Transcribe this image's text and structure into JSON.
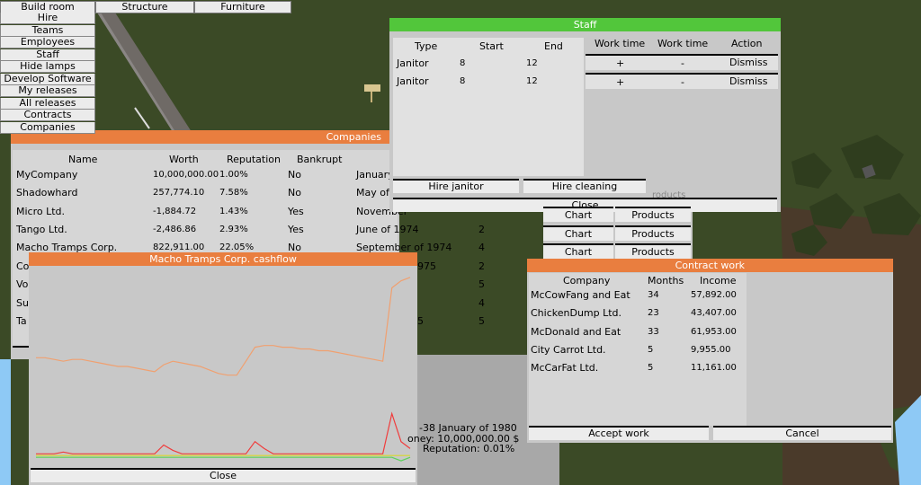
{
  "topbar": {
    "build_room": "Build room",
    "structure": "Structure",
    "furniture": "Furniture"
  },
  "sidebar": [
    "Hire",
    "Teams",
    "Employees",
    "Staff",
    "Hide lamps",
    "Develop Software",
    "My releases",
    "All releases",
    "Contracts",
    "Companies"
  ],
  "companies": {
    "title": "Companies",
    "headers": [
      "Name",
      "Worth",
      "Reputation",
      "Bankrupt"
    ],
    "rows": [
      {
        "name": "MyCompany",
        "worth": "10,000,000.00",
        "reputation": "1.00%",
        "bankrupt": "No",
        "founded": "January",
        "count": ""
      },
      {
        "name": "Shadowhard",
        "worth": "257,774.10",
        "reputation": "7.58%",
        "bankrupt": "No",
        "founded": "May of",
        "count": ""
      },
      {
        "name": "Micro Ltd.",
        "worth": "-1,884.72",
        "reputation": "1.43%",
        "bankrupt": "Yes",
        "founded": "November",
        "count": ""
      },
      {
        "name": "Tango Ltd.",
        "worth": "-2,486.86",
        "reputation": "2.93%",
        "bankrupt": "Yes",
        "founded": "June of 1974",
        "count": "2"
      },
      {
        "name": "Macho Tramps Corp.",
        "worth": "822,911.00",
        "reputation": "22.05%",
        "bankrupt": "No",
        "founded": "September of 1974",
        "count": "4"
      }
    ],
    "partial_rows": [
      {
        "name": "Co",
        "founded": "975",
        "count": "2"
      },
      {
        "name": "Vo",
        "founded": "",
        "count": "5"
      },
      {
        "name": "Su",
        "founded": "",
        "count": "4"
      },
      {
        "name": "Ta",
        "founded": "5",
        "count": "5"
      }
    ]
  },
  "staff": {
    "title": "Staff",
    "headers": [
      "Type",
      "Start",
      "End",
      "Work time",
      "Work time",
      "Action"
    ],
    "rows": [
      {
        "type": "Janitor",
        "start": "8",
        "end": "12",
        "plus": "+",
        "minus": "-",
        "action": "Dismiss"
      },
      {
        "type": "Janitor",
        "start": "8",
        "end": "12",
        "plus": "+",
        "minus": "-",
        "action": "Dismiss"
      }
    ],
    "hire_janitor": "Hire janitor",
    "hire_cleaning": "Hire cleaning",
    "close": "Close",
    "behind_text": "roducts"
  },
  "chart_buttons": [
    {
      "chart": "Chart",
      "products": "Products"
    },
    {
      "chart": "Chart",
      "products": "Products"
    },
    {
      "chart": "Chart",
      "products": "Products"
    }
  ],
  "cashflow": {
    "title": "Macho Tramps Corp. cashflow",
    "close": "Close",
    "chart_data": {
      "type": "line",
      "title": "Macho Tramps Corp. cashflow",
      "xlabel": "",
      "ylabel": "",
      "ylim": [
        0,
        100
      ],
      "series": [
        {
          "color": "#f0a070",
          "values": [
            60,
            60,
            59,
            58,
            59,
            59,
            58,
            57,
            56,
            55,
            55,
            54,
            53,
            52,
            56,
            58,
            57,
            56,
            55,
            53,
            51,
            50,
            50,
            58,
            66,
            67,
            67,
            66,
            66,
            65,
            65,
            64,
            64,
            63,
            62,
            61,
            60,
            59,
            58,
            100,
            104,
            106
          ]
        },
        {
          "color": "#f03c3c",
          "values": [
            5,
            5,
            5,
            6,
            5,
            5,
            5,
            5,
            5,
            5,
            5,
            5,
            5,
            5,
            10,
            7,
            5,
            5,
            5,
            5,
            5,
            5,
            5,
            5,
            12,
            8,
            5,
            5,
            5,
            5,
            5,
            5,
            5,
            5,
            5,
            5,
            5,
            5,
            5,
            28,
            12,
            8
          ]
        },
        {
          "color": "#5ad25a",
          "values": [
            3,
            3,
            3,
            3,
            3,
            3,
            3,
            3,
            3,
            3,
            3,
            3,
            3,
            3,
            3,
            3,
            3,
            3,
            3,
            3,
            3,
            3,
            3,
            3,
            3,
            3,
            3,
            3,
            3,
            3,
            3,
            3,
            3,
            3,
            3,
            3,
            3,
            3,
            3,
            3,
            1,
            3
          ]
        },
        {
          "color": "#d8d82a",
          "values": [
            4,
            4,
            4,
            4,
            4,
            4,
            4,
            4,
            4,
            4,
            4,
            4,
            4,
            4,
            4,
            4,
            4,
            4,
            4,
            4,
            4,
            4,
            4,
            4,
            4,
            4,
            4,
            4,
            4,
            4,
            4,
            4,
            4,
            4,
            4,
            4,
            4,
            4,
            4,
            4,
            4,
            4
          ]
        }
      ]
    }
  },
  "status": {
    "date": "-38 January of 1980",
    "money": "oney: 10,000,000.00 $",
    "reputation": "Reputation: 0.01%"
  },
  "contract": {
    "title": "Contract work",
    "headers": [
      "Company",
      "Months",
      "Income"
    ],
    "rows": [
      {
        "company": "McCowFang and Eat",
        "months": "34",
        "income": "57,892.00"
      },
      {
        "company": "ChickenDump Ltd.",
        "months": "23",
        "income": "43,407.00"
      },
      {
        "company": "McDonald and Eat",
        "months": "33",
        "income": "61,953.00"
      },
      {
        "company": "City Carrot Ltd.",
        "months": "5",
        "income": "9,955.00"
      },
      {
        "company": "McCarFat Ltd.",
        "months": "5",
        "income": "11,161.00"
      }
    ],
    "accept": "Accept work",
    "cancel": "Cancel"
  },
  "colors": {
    "accent_orange": "#e97e3f",
    "accent_green": "#52c63b",
    "panel": "#c8c8c8",
    "grass": "#3b4a26",
    "sky": "#8ec9f5"
  }
}
